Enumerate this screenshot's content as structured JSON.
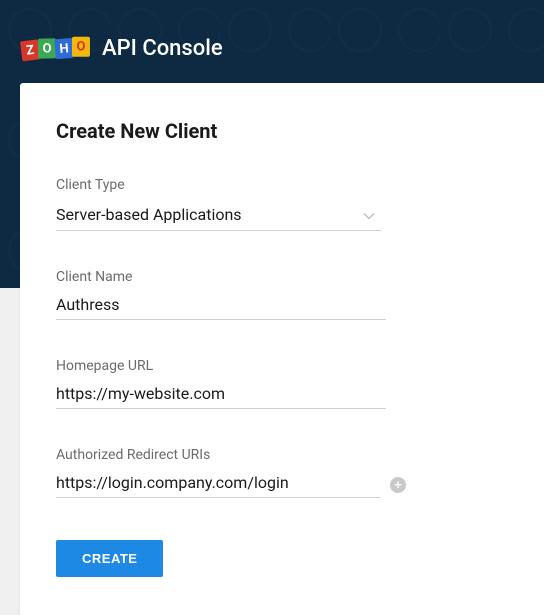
{
  "header": {
    "logo_letters": [
      "Z",
      "O",
      "H",
      "O"
    ],
    "app_title": "API Console"
  },
  "form": {
    "title": "Create New Client",
    "client_type": {
      "label": "Client Type",
      "value": "Server-based Applications"
    },
    "client_name": {
      "label": "Client Name",
      "value": "Authress"
    },
    "homepage_url": {
      "label": "Homepage URL",
      "value": "https://my-website.com"
    },
    "redirect_uris": {
      "label": "Authorized Redirect URIs",
      "value": "https://login.company.com/login"
    },
    "create_button": "CREATE"
  }
}
